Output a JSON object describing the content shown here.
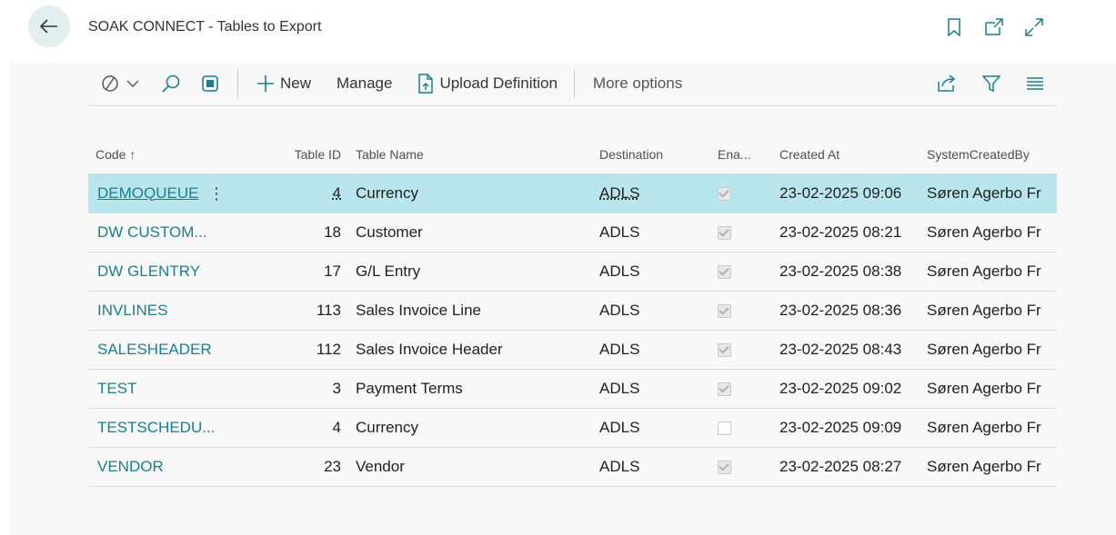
{
  "header": {
    "title": "SOAK CONNECT - Tables to Export"
  },
  "toolbar": {
    "new_label": "New",
    "manage_label": "Manage",
    "upload_label": "Upload Definition",
    "more_label": "More options"
  },
  "table": {
    "columns": {
      "code": "Code ↑",
      "table_id": "Table ID",
      "table_name": "Table Name",
      "destination": "Destination",
      "enabled": "Ena...",
      "created_at": "Created At",
      "created_by": "SystemCreatedBy"
    },
    "rows": [
      {
        "code": "DEMOQUEUE",
        "table_id": "4",
        "table_name": "Currency",
        "destination": "ADLS",
        "enabled": true,
        "created_at": "23-02-2025 09:06",
        "created_by": "Søren Agerbo Fr"
      },
      {
        "code": "DW CUSTOM...",
        "table_id": "18",
        "table_name": "Customer",
        "destination": "ADLS",
        "enabled": true,
        "created_at": "23-02-2025 08:21",
        "created_by": "Søren Agerbo Fr"
      },
      {
        "code": "DW GLENTRY",
        "table_id": "17",
        "table_name": "G/L Entry",
        "destination": "ADLS",
        "enabled": true,
        "created_at": "23-02-2025 08:38",
        "created_by": "Søren Agerbo Fr"
      },
      {
        "code": "INVLINES",
        "table_id": "113",
        "table_name": "Sales Invoice Line",
        "destination": "ADLS",
        "enabled": true,
        "created_at": "23-02-2025 08:36",
        "created_by": "Søren Agerbo Fr"
      },
      {
        "code": "SALESHEADER",
        "table_id": "112",
        "table_name": "Sales Invoice Header",
        "destination": "ADLS",
        "enabled": true,
        "created_at": "23-02-2025 08:43",
        "created_by": "Søren Agerbo Fr"
      },
      {
        "code": "TEST",
        "table_id": "3",
        "table_name": "Payment Terms",
        "destination": "ADLS",
        "enabled": true,
        "created_at": "23-02-2025 09:02",
        "created_by": "Søren Agerbo Fr"
      },
      {
        "code": "TESTSCHEDU...",
        "table_id": "4",
        "table_name": "Currency",
        "destination": "ADLS",
        "enabled": false,
        "created_at": "23-02-2025 09:09",
        "created_by": "Søren Agerbo Fr"
      },
      {
        "code": "VENDOR",
        "table_id": "23",
        "table_name": "Vendor",
        "destination": "ADLS",
        "enabled": true,
        "created_at": "23-02-2025 08:27",
        "created_by": "Søren Agerbo Fr"
      }
    ]
  },
  "colors": {
    "accent": "#1a7e8f",
    "selected_row": "#b9e6ec",
    "back_button_bg": "#e3eef1"
  }
}
